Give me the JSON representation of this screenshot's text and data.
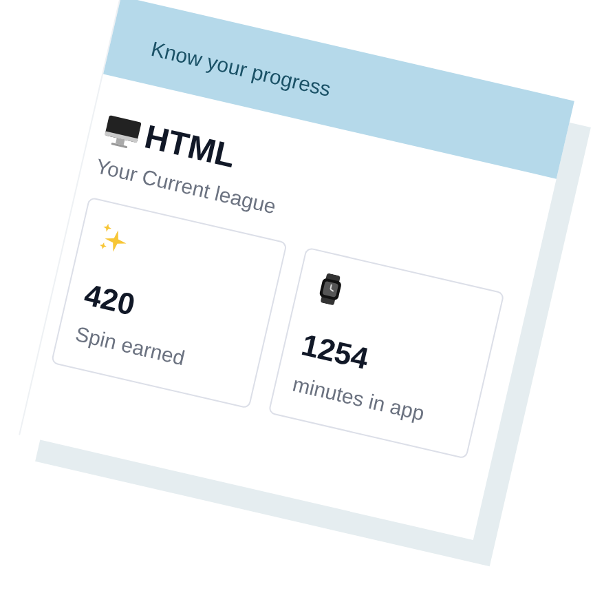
{
  "header": {
    "title": "Know your progress"
  },
  "league": {
    "name": "HTML",
    "subtitle": "Your Current league"
  },
  "stats": [
    {
      "kind": "sparkles",
      "value": "420",
      "label": "Spin earned"
    },
    {
      "kind": "watch",
      "value": "1254",
      "label": "minutes in app"
    }
  ]
}
